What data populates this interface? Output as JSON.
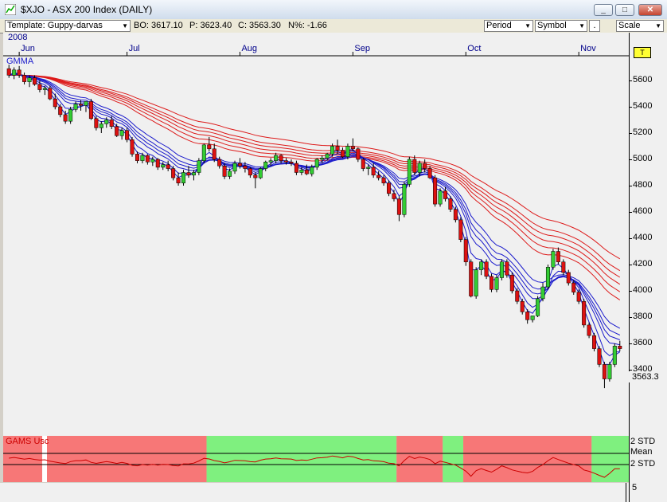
{
  "window": {
    "title": "$XJO - ASX 200 Index (DAILY)",
    "minimize_glyph": "_",
    "maximize_glyph": "□",
    "close_glyph": "✕"
  },
  "toolbar": {
    "template_label": "Template: Guppy-darvas",
    "bo_label": "BO: 3617.10",
    "p_label": "P: 3623.40",
    "c_label": "C: 3563.30",
    "n_label": "N%: -1.66",
    "period_label": "Period",
    "symbol_label": "Symbol",
    "dot_label": ".",
    "scale_label": "Scale"
  },
  "chart": {
    "year_label": "2008",
    "indicator_label": "GMMA",
    "months": [
      "Jun",
      "Jul",
      "Aug",
      "Sep",
      "Oct",
      "Nov"
    ],
    "last_price_label": "3563.3",
    "t_marker": "T",
    "std_upper": "2 STD",
    "mean_label": "Mean",
    "std_lower": "2 STD",
    "lower_indicator_label": "GAMS Usc",
    "bottom_value": "5"
  },
  "colors": {
    "up_candle": "#33cc33",
    "down_candle": "#dd1111",
    "short_ema": "#1a1acc",
    "long_ema": "#dd1a1a",
    "zone_red": "#f77777",
    "zone_green": "#7ff07f"
  },
  "chart_data": {
    "type": "candlestick",
    "title": "$XJO - ASX 200 Index (DAILY)",
    "y_ticks": [
      3400,
      3600,
      3800,
      4000,
      4200,
      4400,
      4600,
      4800,
      5000,
      5200,
      5400,
      5600
    ],
    "ylim": [
      3200,
      5800
    ],
    "x_tick_labels": [
      "Jun",
      "Jul",
      "Aug",
      "Sep",
      "Oct",
      "Nov"
    ],
    "last_close": 3563.3,
    "ohlc": [
      [
        5690,
        5720,
        5620,
        5640
      ],
      [
        5640,
        5700,
        5610,
        5680
      ],
      [
        5680,
        5710,
        5620,
        5640
      ],
      [
        5640,
        5660,
        5570,
        5590
      ],
      [
        5590,
        5640,
        5550,
        5620
      ],
      [
        5620,
        5640,
        5560,
        5570
      ],
      [
        5570,
        5600,
        5510,
        5530
      ],
      [
        5530,
        5560,
        5490,
        5540
      ],
      [
        5540,
        5560,
        5450,
        5460
      ],
      [
        5460,
        5500,
        5380,
        5400
      ],
      [
        5400,
        5420,
        5320,
        5340
      ],
      [
        5340,
        5370,
        5270,
        5290
      ],
      [
        5290,
        5400,
        5270,
        5380
      ],
      [
        5380,
        5440,
        5360,
        5420
      ],
      [
        5420,
        5450,
        5370,
        5410
      ],
      [
        5410,
        5440,
        5360,
        5440
      ],
      [
        5440,
        5460,
        5300,
        5310
      ],
      [
        5310,
        5330,
        5220,
        5240
      ],
      [
        5240,
        5290,
        5200,
        5270
      ],
      [
        5270,
        5320,
        5240,
        5300
      ],
      [
        5300,
        5330,
        5230,
        5250
      ],
      [
        5250,
        5270,
        5170,
        5180
      ],
      [
        5180,
        5240,
        5150,
        5220
      ],
      [
        5220,
        5240,
        5130,
        5150
      ],
      [
        5150,
        5170,
        5020,
        5040
      ],
      [
        5040,
        5060,
        4970,
        4990
      ],
      [
        4990,
        5050,
        4970,
        5030
      ],
      [
        5030,
        5040,
        4960,
        4980
      ],
      [
        4980,
        5020,
        4950,
        5000
      ],
      [
        5000,
        5010,
        4920,
        4940
      ],
      [
        4940,
        4980,
        4920,
        4960
      ],
      [
        4960,
        4990,
        4910,
        4930
      ],
      [
        4930,
        4950,
        4840,
        4860
      ],
      [
        4860,
        4900,
        4800,
        4820
      ],
      [
        4820,
        4920,
        4800,
        4900
      ],
      [
        4900,
        4950,
        4860,
        4880
      ],
      [
        4880,
        4920,
        4840,
        4900
      ],
      [
        4900,
        5010,
        4880,
        4990
      ],
      [
        4990,
        5120,
        4970,
        5110
      ],
      [
        5110,
        5170,
        5060,
        5080
      ],
      [
        5080,
        5120,
        4980,
        5000
      ],
      [
        5000,
        5020,
        4930,
        4950
      ],
      [
        4950,
        4970,
        4850,
        4870
      ],
      [
        4870,
        4930,
        4850,
        4910
      ],
      [
        4910,
        4990,
        4890,
        4970
      ],
      [
        4970,
        5010,
        4930,
        4950
      ],
      [
        4950,
        4980,
        4900,
        4930
      ],
      [
        4930,
        4940,
        4860,
        4880
      ],
      [
        4880,
        4900,
        4780,
        4860
      ],
      [
        4860,
        4940,
        4850,
        4930
      ],
      [
        4930,
        4990,
        4910,
        4980
      ],
      [
        4980,
        5010,
        4950,
        4990
      ],
      [
        4990,
        5050,
        4970,
        5030
      ],
      [
        5030,
        5040,
        4970,
        4990
      ],
      [
        4990,
        5010,
        4960,
        4980
      ],
      [
        4980,
        5000,
        4950,
        4970
      ],
      [
        4970,
        4990,
        4880,
        4900
      ],
      [
        4900,
        4940,
        4880,
        4920
      ],
      [
        4920,
        4960,
        4880,
        4890
      ],
      [
        4890,
        4960,
        4870,
        4940
      ],
      [
        4940,
        5010,
        4920,
        5000
      ],
      [
        5000,
        5030,
        4970,
        5010
      ],
      [
        5010,
        5050,
        4990,
        5040
      ],
      [
        5040,
        5120,
        5020,
        5100
      ],
      [
        5100,
        5150,
        5040,
        5070
      ],
      [
        5070,
        5090,
        5010,
        5020
      ],
      [
        5020,
        5120,
        5000,
        5100
      ],
      [
        5100,
        5160,
        5060,
        5080
      ],
      [
        5080,
        5090,
        4980,
        5000
      ],
      [
        5000,
        5010,
        4910,
        4930
      ],
      [
        4930,
        4960,
        4880,
        4940
      ],
      [
        4940,
        4970,
        4860,
        4880
      ],
      [
        4880,
        4910,
        4840,
        4860
      ],
      [
        4860,
        4880,
        4800,
        4820
      ],
      [
        4820,
        4840,
        4720,
        4740
      ],
      [
        4740,
        4770,
        4680,
        4700
      ],
      [
        4700,
        4720,
        4530,
        4580
      ],
      [
        4580,
        4830,
        4560,
        4810
      ],
      [
        4810,
        5020,
        4790,
        5000
      ],
      [
        5000,
        5030,
        4880,
        4900
      ],
      [
        4900,
        4990,
        4870,
        4970
      ],
      [
        4970,
        5000,
        4900,
        4930
      ],
      [
        4930,
        4950,
        4850,
        4860
      ],
      [
        4860,
        4880,
        4640,
        4660
      ],
      [
        4660,
        4780,
        4640,
        4760
      ],
      [
        4760,
        4790,
        4680,
        4700
      ],
      [
        4700,
        4720,
        4600,
        4620
      ],
      [
        4620,
        4640,
        4520,
        4540
      ],
      [
        4540,
        4560,
        4370,
        4390
      ],
      [
        4390,
        4410,
        4190,
        4220
      ],
      [
        4220,
        4240,
        3950,
        3960
      ],
      [
        3960,
        4180,
        3940,
        4160
      ],
      [
        4160,
        4240,
        4120,
        4220
      ],
      [
        4220,
        4240,
        4090,
        4110
      ],
      [
        4110,
        4130,
        3990,
        4010
      ],
      [
        4010,
        4120,
        3990,
        4100
      ],
      [
        4100,
        4240,
        4080,
        4220
      ],
      [
        4220,
        4240,
        4100,
        4120
      ],
      [
        4120,
        4140,
        3980,
        4000
      ],
      [
        4000,
        4020,
        3900,
        3920
      ],
      [
        3920,
        3940,
        3820,
        3840
      ],
      [
        3840,
        3860,
        3750,
        3780
      ],
      [
        3780,
        3800,
        3760,
        3810
      ],
      [
        3810,
        3960,
        3800,
        3940
      ],
      [
        3940,
        4060,
        3920,
        4030
      ],
      [
        4030,
        4200,
        4010,
        4180
      ],
      [
        4180,
        4320,
        4160,
        4300
      ],
      [
        4300,
        4330,
        4200,
        4220
      ],
      [
        4220,
        4240,
        4120,
        4140
      ],
      [
        4140,
        4160,
        4040,
        4060
      ],
      [
        4060,
        4080,
        3970,
        3990
      ],
      [
        3990,
        4010,
        3900,
        3920
      ],
      [
        3920,
        3940,
        3720,
        3740
      ],
      [
        3740,
        3760,
        3640,
        3660
      ],
      [
        3660,
        3680,
        3540,
        3560
      ],
      [
        3560,
        3580,
        3420,
        3440
      ],
      [
        3440,
        3460,
        3260,
        3330
      ],
      [
        3330,
        3460,
        3310,
        3440
      ],
      [
        3440,
        3600,
        3420,
        3580
      ],
      [
        3580,
        3620,
        3540,
        3560
      ]
    ],
    "short_emas": [
      3,
      5,
      8,
      10,
      12,
      15
    ],
    "long_emas": [
      30,
      35,
      40,
      45,
      50,
      60
    ],
    "lower_panel": {
      "zones": [
        {
          "from": 0,
          "to": 39,
          "state": "red"
        },
        {
          "from": 39,
          "to": 76,
          "state": "green"
        },
        {
          "from": 76,
          "to": 85,
          "state": "red"
        },
        {
          "from": 85,
          "to": 89,
          "state": "green"
        },
        {
          "from": 89,
          "to": 114,
          "state": "red"
        },
        {
          "from": 114,
          "to": 123,
          "state": "green"
        },
        {
          "from": 123,
          "to": 132,
          "state": "red"
        }
      ]
    }
  }
}
